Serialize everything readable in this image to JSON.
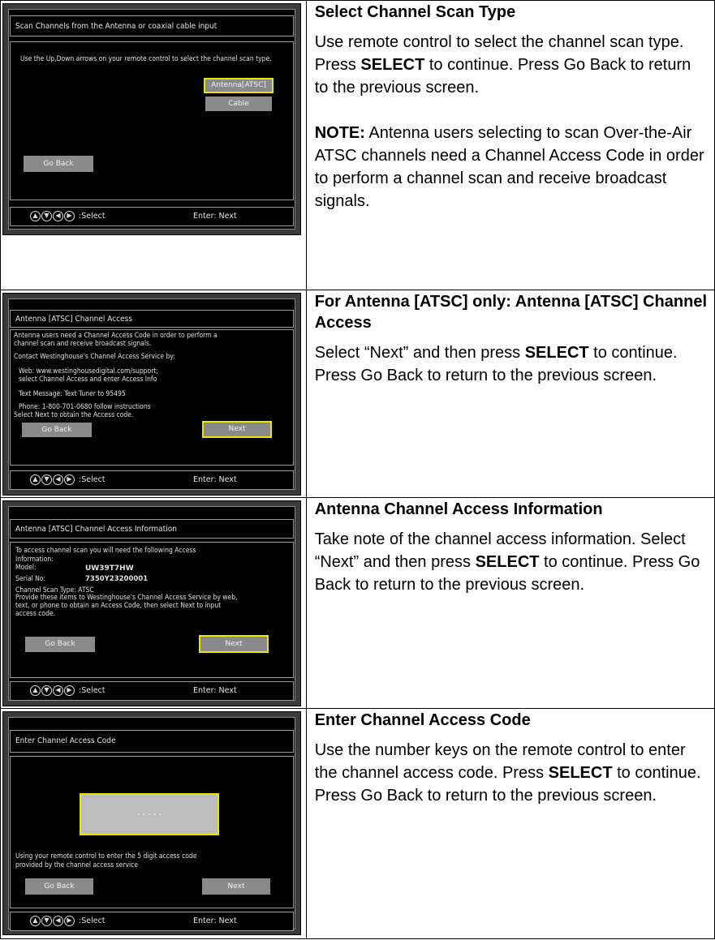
{
  "rows": [
    {
      "heading": "Select Channel Scan Type",
      "para1_parts": [
        "Use remote control to select the channel scan type. Press ",
        "SELECT",
        " to continue. Press Go Back to return to the previous screen."
      ],
      "note_label": "NOTE:",
      "note_text": " Antenna users selecting to scan Over-the-Air ATSC channels need a Channel Access Code in order to perform a channel scan and receive broadcast signals.",
      "screen": {
        "title": "Scan Channels from the Antenna or coaxial cable input",
        "instructions": "Use the Up,Down arrows on your remote control to select the channel scan type.",
        "option_antenna": "Antenna[ATSC]",
        "option_cable": "Cable",
        "go_back": "Go Back",
        "footer_select": ":Select",
        "footer_enter": "Enter: Next"
      }
    },
    {
      "heading": "For Antenna [ATSC] only: Antenna [ATSC] Channel Access",
      "para1_parts": [
        "Select “Next” and then press ",
        "SELECT",
        " to continue. Press Go Back to return to the previous screen."
      ],
      "screen": {
        "title": "Antenna [ATSC] Channel Access",
        "line1": "Antenna users need a Channel Access Code in order to perform a",
        "line2": "channel scan and receive broadcast signals.",
        "line3": "Contact Westinghouse's Channel Access Service by:",
        "line4": "Web: www.westinghousedigital.com/support;",
        "line5": "select Channel Access and enter Access Info",
        "line6": "Text Message: Text Tuner to 95495",
        "line7": "Phone: 1-800-701-0680 follow instructions",
        "line8": "Select Next to obtain the Access code.",
        "go_back": "Go Back",
        "next": "Next",
        "footer_select": ":Select",
        "footer_enter": "Enter: Next"
      }
    },
    {
      "heading": "Antenna Channel Access Information",
      "para1_parts": [
        "Take note of the channel access information. Select “Next” and then press ",
        "SELECT",
        " to continue. Press Go Back to return to the previous screen."
      ],
      "screen": {
        "title": "Antenna [ATSC] Channel Access Information",
        "line1": "To access channel scan you will need the following  Access",
        "line2": "Information:",
        "model_label": "Model:",
        "model_value": "UW39T7HW",
        "serial_label": "Serial No:",
        "serial_value": "7350Y23200001",
        "line3": "Channel Scan Type: ATSC",
        "line4": "Provide these items to Westinghouse's Channel Access Service by web,",
        "line5": "text, or phone to obtain an Access Code, then select Next to input",
        "line6": "access code.",
        "go_back": "Go Back",
        "next": "Next",
        "footer_select": ":Select",
        "footer_enter": "Enter: Next"
      }
    },
    {
      "heading": "Enter Channel Access Code",
      "para1_parts": [
        "Use the number keys on the remote control to enter the channel access code. Press ",
        "SELECT",
        " to continue. Press Go Back to return to the previous screen."
      ],
      "screen": {
        "title": "Enter Channel Access Code",
        "code_placeholder": "- - - - -",
        "line1": "Using your remote control to enter the 5 digit access code",
        "line2": "provided by the channel access service",
        "go_back": "Go Back",
        "next": "Next",
        "footer_select": ":Select",
        "footer_enter": "Enter: Next"
      }
    }
  ],
  "arrow_icons": [
    "up-arrow-icon",
    "down-arrow-icon",
    "left-arrow-icon",
    "right-arrow-icon"
  ],
  "colors": {
    "highlight": "#e6e600",
    "button": "#8a8a8a",
    "screen_bg": "#000000",
    "frame": "#3b3b3b"
  }
}
